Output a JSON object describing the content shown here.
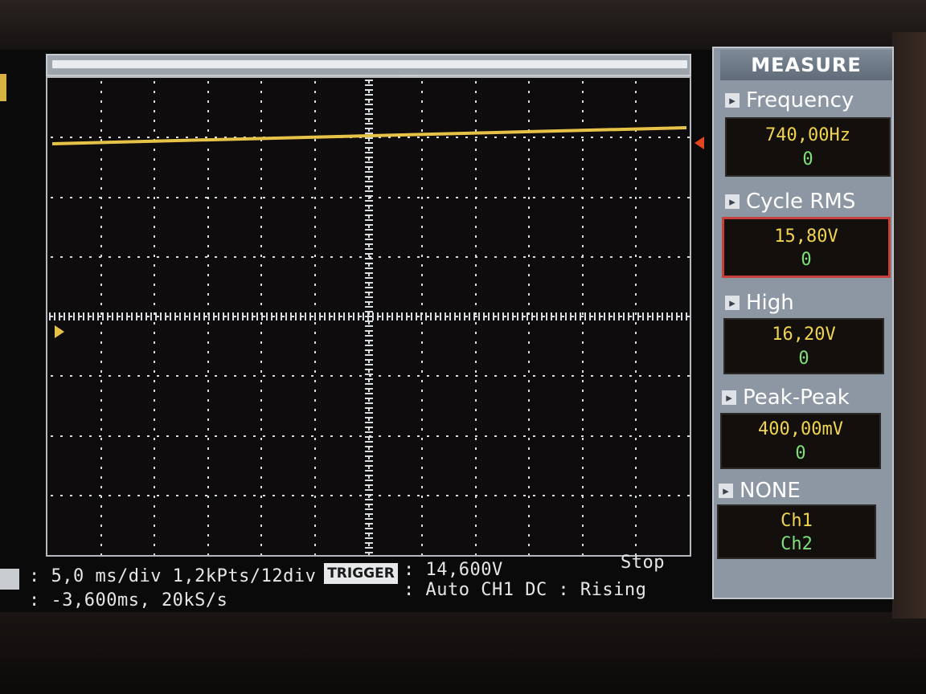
{
  "measure": {
    "title": "MEASURE",
    "items": [
      {
        "label": "Frequency",
        "value": "740,00Hz",
        "sub": "0",
        "selected": false
      },
      {
        "label": "Cycle RMS",
        "value": "15,80V",
        "sub": "0",
        "selected": true
      },
      {
        "label": "High",
        "value": "16,20V",
        "sub": "0",
        "selected": false
      },
      {
        "label": "Peak-Peak",
        "value": "400,00mV",
        "sub": "0",
        "selected": false
      },
      {
        "label": "NONE",
        "value": "Ch1",
        "sub": "Ch2",
        "selected": false
      }
    ]
  },
  "status": {
    "timebase": ": 5,0 ms/div 1,2kPts/12div",
    "offset": ": -3,600ms, 20kS/s",
    "trigger_label": "TRIGGER",
    "trigger_level": ": 14,600V",
    "run_state": "Stop",
    "trigger_mode": ": Auto CH1 DC : Rising"
  },
  "colors": {
    "trace": "#e6c347",
    "grid": "#d8dde2",
    "trigger_marker": "#e0461f",
    "measure_value": "#f0d44f",
    "measure_sub": "#7fe07a"
  }
}
